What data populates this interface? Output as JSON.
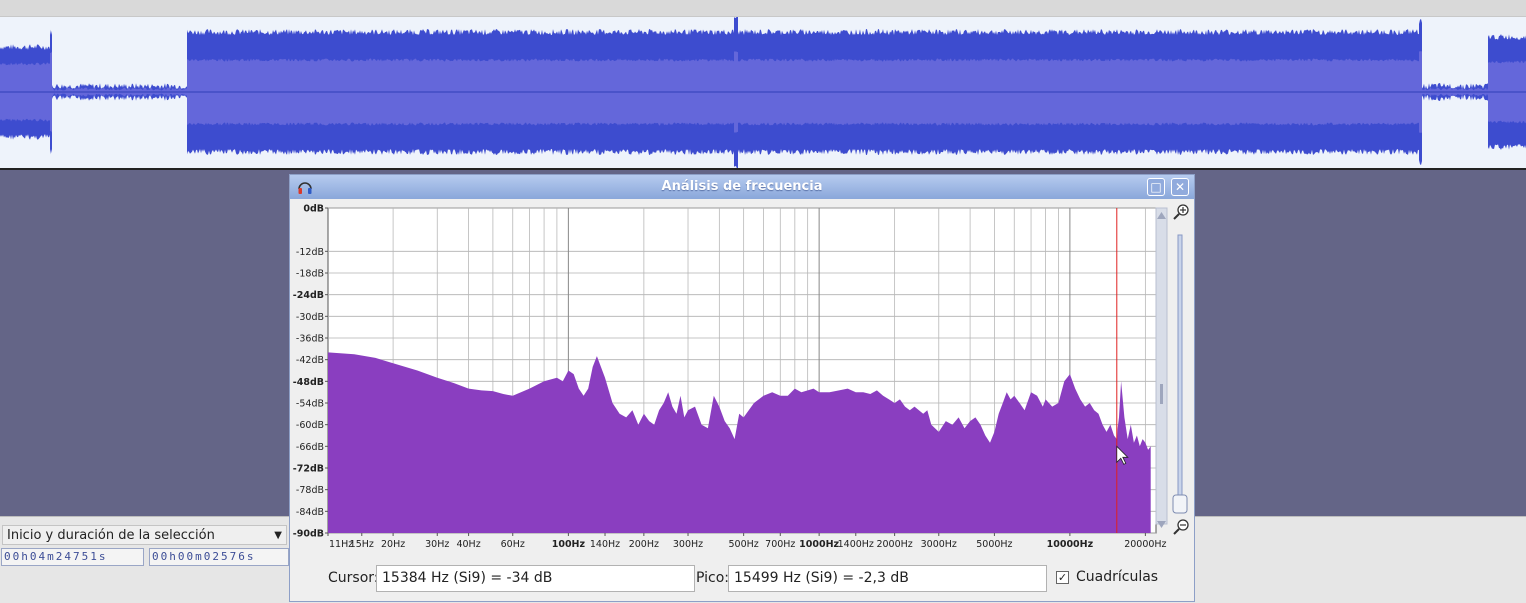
{
  "window": {
    "title": "Análisis de frecuencia"
  },
  "toolbar": {
    "selection_mode": "Inicio y duración de la selección",
    "start_time": "00h04m24751s",
    "length_time": "00h00m02576s"
  },
  "analysis": {
    "cursor_label": "Cursor:",
    "cursor_value": "15384 Hz (Si9) = -34 dB",
    "peak_label": "Pico:",
    "peak_value": "15499 Hz (Si9) = -2,3 dB",
    "grids_label": "Cuadrículas",
    "grids_checked": true
  },
  "icons": [
    "headphones-icon",
    "maximize-icon",
    "close-icon",
    "zoom-in-icon",
    "zoom-out-icon",
    "scroll-up-icon",
    "scroll-down-icon",
    "dropdown-arrow-icon"
  ],
  "colors": {
    "spectrum_fill": "#8a3ec0",
    "waveform": "#3d4ccf",
    "waveform_rms": "#6467da",
    "cursor_line": "#e02020",
    "titlebar": "#9cb4e2"
  },
  "chart_data": {
    "type": "area",
    "title": "",
    "xlabel": "",
    "ylabel": "",
    "x_scale": "log",
    "xlim": [
      11,
      22050
    ],
    "ylim": [
      -90,
      0
    ],
    "grid": true,
    "y_ticks": [
      "0dB",
      "-12dB",
      "-18dB",
      "-24dB",
      "-30dB",
      "-36dB",
      "-42dB",
      "-48dB",
      "-54dB",
      "-60dB",
      "-66dB",
      "-72dB",
      "-78dB",
      "-84dB",
      "-90dB"
    ],
    "y_tick_values": [
      0,
      -12,
      -18,
      -24,
      -30,
      -36,
      -42,
      -48,
      -54,
      -60,
      -66,
      -72,
      -78,
      -84,
      -90
    ],
    "x_ticks": [
      "11Hz",
      "15Hz",
      "20Hz",
      "30Hz",
      "40Hz",
      "60Hz",
      "100Hz",
      "140Hz",
      "200Hz",
      "300Hz",
      "500Hz",
      "700Hz",
      "1000Hz",
      "1400Hz",
      "2000Hz",
      "3000Hz",
      "5000Hz",
      "10000Hz",
      "20000Hz"
    ],
    "x_tick_values": [
      11,
      15,
      20,
      30,
      40,
      60,
      100,
      140,
      200,
      300,
      500,
      700,
      1000,
      1400,
      2000,
      3000,
      5000,
      10000,
      20000
    ],
    "x": [
      11,
      14,
      17,
      20,
      25,
      30,
      35,
      40,
      45,
      50,
      55,
      60,
      70,
      80,
      90,
      95,
      100,
      105,
      110,
      115,
      120,
      125,
      130,
      140,
      150,
      160,
      170,
      180,
      190,
      200,
      210,
      220,
      230,
      240,
      250,
      260,
      270,
      280,
      290,
      300,
      320,
      340,
      360,
      380,
      400,
      420,
      440,
      460,
      480,
      500,
      550,
      600,
      650,
      700,
      750,
      800,
      850,
      900,
      950,
      1000,
      1100,
      1200,
      1300,
      1400,
      1500,
      1600,
      1700,
      1800,
      1900,
      2000,
      2100,
      2200,
      2300,
      2400,
      2500,
      2600,
      2700,
      2800,
      3000,
      3200,
      3400,
      3600,
      3800,
      4000,
      4200,
      4400,
      4600,
      4800,
      5000,
      5200,
      5400,
      5600,
      5800,
      6000,
      6300,
      6600,
      7000,
      7400,
      7800,
      8000,
      8500,
      9000,
      9500,
      10000,
      10500,
      11000,
      11500,
      12000,
      12500,
      13000,
      13500,
      14000,
      14500,
      15000,
      15384,
      15499,
      15700,
      16000,
      16500,
      17000,
      17500,
      18000,
      18500,
      19000,
      19500,
      20000,
      20500,
      21000
    ],
    "values": [
      -40,
      -40.5,
      -41.5,
      -43,
      -45,
      -47,
      -48.5,
      -50,
      -50.5,
      -50.7,
      -51.5,
      -52,
      -50,
      -48,
      -47,
      -48,
      -45,
      -46,
      -50,
      -52,
      -50,
      -44,
      -41,
      -47,
      -54,
      -57,
      -58,
      -56,
      -60,
      -57,
      -59,
      -60,
      -56,
      -54,
      -51,
      -55,
      -57,
      -52,
      -58,
      -56,
      -55,
      -60,
      -61,
      -52,
      -55,
      -59,
      -61,
      -64,
      -57,
      -58,
      -54,
      -52,
      -51,
      -52,
      -52,
      -50,
      -51,
      -50.5,
      -50,
      -51,
      -51,
      -50.5,
      -50,
      -51,
      -51,
      -51.5,
      -50.5,
      -52,
      -53,
      -54,
      -53,
      -55,
      -56,
      -55,
      -56,
      -57,
      -56,
      -60,
      -62,
      -59,
      -60,
      -58,
      -61,
      -59,
      -58,
      -60,
      -63,
      -65,
      -62,
      -57,
      -54,
      -51,
      -53,
      -52,
      -54,
      -56,
      -51,
      -52,
      -55,
      -53,
      -55,
      -54,
      -48,
      -46,
      -50,
      -53,
      -55,
      -54,
      -56,
      -57,
      -60,
      -62,
      -60,
      -63,
      -64,
      -61,
      -58,
      -48,
      -58,
      -64,
      -60,
      -65,
      -63,
      -66,
      -64,
      -65,
      -67,
      -66,
      -67,
      -69
    ]
  }
}
